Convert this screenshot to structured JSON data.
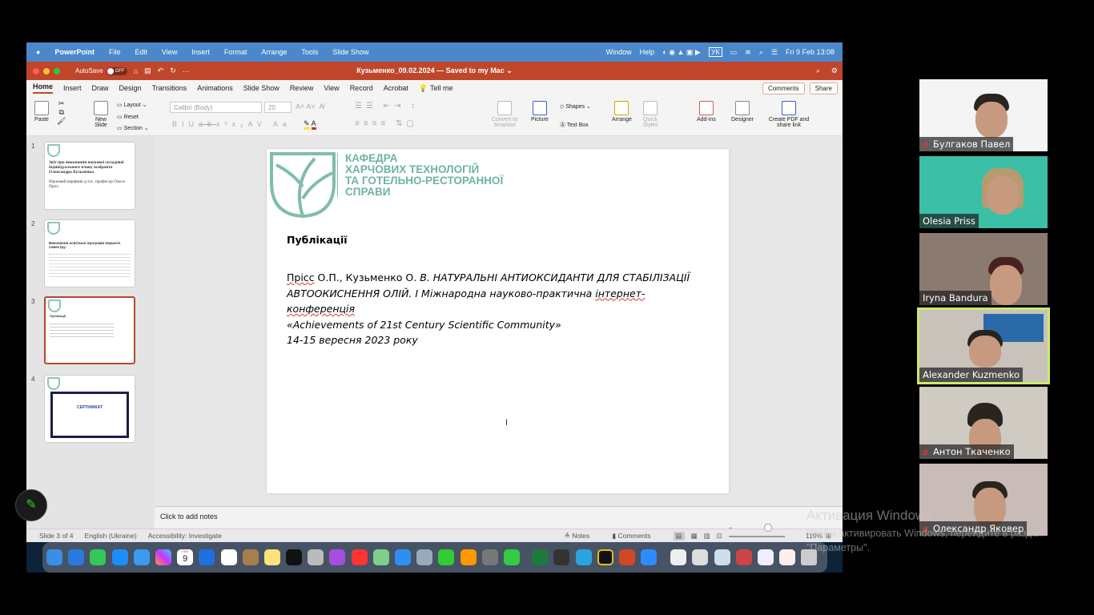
{
  "menubar": {
    "app": "PowerPoint",
    "items": [
      "File",
      "Edit",
      "View",
      "Insert",
      "Format",
      "Arrange",
      "Tools",
      "Slide Show"
    ],
    "right_items": [
      "Window",
      "Help"
    ],
    "keyboard": "УК",
    "datetime": "Fri 9 Feb  13:08"
  },
  "titlebar": {
    "autosave": "AutoSave",
    "autosave_state": "OFF",
    "doc_title": "Кузьменко_09.02.2024 — Saved to my Mac ⌄"
  },
  "tabs": [
    "Home",
    "Insert",
    "Draw",
    "Design",
    "Transitions",
    "Animations",
    "Slide Show",
    "Review",
    "View",
    "Record",
    "Acrobat",
    "Tell me"
  ],
  "active_tab": "Home",
  "comments_btn": "Comments",
  "share_btn": "Share",
  "ribbon": {
    "paste": "Paste",
    "new_slide": "New Slide",
    "layout": "Layout",
    "reset": "Reset",
    "section": "Section",
    "font": "Calibri (Body)",
    "size": "20",
    "convert": "Convert to SmartArt",
    "picture": "Picture",
    "shapes": "Shapes",
    "text_box": "Text Box",
    "arrange": "Arrange",
    "quick_styles": "Quick Styles",
    "addins": "Add-ins",
    "designer": "Designer",
    "create_pdf": "Create PDF and share link"
  },
  "thumbnails": [
    {
      "num": "1",
      "title": "Звіт про виконання наукової складової індивідуального плану аспіранта Олександра Кузьменка",
      "sub": "Науковий керівник  д.т.н., професор Олеся Прісс"
    },
    {
      "num": "2",
      "title": "Виконання освітньої програми  першого семестру:"
    },
    {
      "num": "3",
      "title": "Публікації"
    },
    {
      "num": "4",
      "title": "СЕРТИФІКАТ"
    }
  ],
  "slide": {
    "logo_lines": [
      "КАФЕДРА",
      "ХАРЧОВИХ ТЕХНОЛОГІЙ",
      "ТА ГОТЕЛЬНО-РЕСТОРАННОЇ",
      "СПРАВИ"
    ],
    "heading": "Публікації",
    "author1": "Прісс",
    "authors_rest": " О.П., Кузьменко О. ",
    "title_italic": "В. НАТУРАЛЬНІ АНТИОКСИДАНТИ ДЛЯ СТАБІЛІЗАЦІЇ АВТООКИСНЕННЯ ОЛІЙ. І Міжнародна науково-практична ",
    "word_internet": "інтернет-",
    "word_conf": "конференція",
    "conf_name": "«Achievements of 21st Century Scientific Community»",
    "dates": "14-15 вересня 2023 року"
  },
  "notes_placeholder": "Click to add notes",
  "status": {
    "slide": "Slide 3 of 4",
    "language": "English (Ukraine)",
    "accessibility": "Accessibility: Investigate",
    "notes": "Notes",
    "comments": "Comments",
    "zoom": "119%"
  },
  "zoom_level_percent": 119,
  "participants": [
    {
      "name": "Булгаков Павел",
      "muted": true
    },
    {
      "name": "Olesia Priss",
      "muted": false
    },
    {
      "name": "Iryna Bandura",
      "muted": false
    },
    {
      "name": "Alexander Kuzmenko",
      "muted": false,
      "speaking": true
    },
    {
      "name": "Антон Ткаченко",
      "muted": true
    },
    {
      "name": "Олександр Яковер",
      "muted": true
    }
  ],
  "watermark": {
    "title": "Активация Windows",
    "text": "Чтобы активировать Windows, перейдите в раздел \"Параметры\"."
  },
  "dock_calendar": {
    "month": "FEB",
    "day": "9"
  }
}
